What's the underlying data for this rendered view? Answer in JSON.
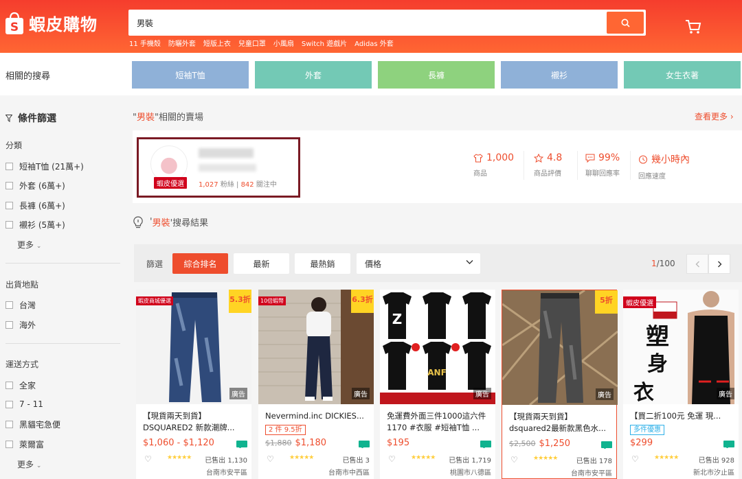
{
  "header": {
    "logo_text": "蝦皮購物",
    "search_value": "男裝",
    "hot_words": [
      "11 手機殼",
      "防曬外套",
      "短版上衣",
      "兒童口罩",
      "小風扇",
      "Switch 遊戲片",
      "Adidas 外套"
    ]
  },
  "related": {
    "title": "相關的搜尋",
    "chips": [
      {
        "label": "短袖T恤",
        "color": "#8fb1d8"
      },
      {
        "label": "外套",
        "color": "#73c9b5"
      },
      {
        "label": "長褲",
        "color": "#8ed27e"
      },
      {
        "label": "襯衫",
        "color": "#8fb1d8"
      },
      {
        "label": "女生衣著",
        "color": "#73c9b5"
      }
    ]
  },
  "sidebar": {
    "filter_title": "條件篩選",
    "category": {
      "title": "分類",
      "items": [
        "短袖T恤 (21萬+)",
        "外套 (6萬+)",
        "長褲 (6萬+)",
        "襯衫 (5萬+)"
      ],
      "more": "更多"
    },
    "location": {
      "title": "出貨地點",
      "items": [
        "台灣",
        "海外"
      ]
    },
    "shipping": {
      "title": "運送方式",
      "items": [
        "全家",
        "7 - 11",
        "黑貓宅急便",
        "萊爾富"
      ],
      "more": "更多"
    }
  },
  "shop_section": {
    "prefix": "\"",
    "keyword": "男裝",
    "suffix": "\"相關的賣場",
    "see_more": "查看更多 ›",
    "badge": "蝦皮優選",
    "followers": "1,027",
    "followers_label": "粉絲",
    "following": "842",
    "following_label": "關注中",
    "stats": [
      {
        "value": "1,000",
        "label": "商品",
        "icon": "shirt-icon"
      },
      {
        "value": "4.8",
        "label": "商品評價",
        "icon": "star-icon"
      },
      {
        "value": "99%",
        "label": "聊聊回應率",
        "icon": "chat-icon"
      },
      {
        "value": "幾小時內",
        "label": "回應速度",
        "icon": "clock-icon"
      }
    ]
  },
  "results": {
    "prefix": "'",
    "keyword": "男裝",
    "suffix": "'搜尋結果"
  },
  "sort_bar": {
    "label": "篩選",
    "options": [
      "綜合排名",
      "最新",
      "最熱銷"
    ],
    "active_index": 0,
    "price_label": "價格",
    "page_current": "1",
    "page_total": "/100"
  },
  "products": [
    {
      "name": "【現貨兩天到貨】DSQUARED2 新款潮牌...",
      "chip": "",
      "old_price": "",
      "price": "$1,060 - $1,120",
      "sold": "已售出 1,130",
      "location": "台南市安平區",
      "discount": "5.3折",
      "tag": "蝦皮商城優選",
      "ad": "廣告",
      "rating": 5,
      "highlight": false
    },
    {
      "name": "Nevermind.inc DICKIES...",
      "chip": "2 件 9.5折",
      "old_price": "$1,880",
      "price": "$1,180",
      "sold": "已售出 3",
      "location": "台南市中西區",
      "discount": "6.3折",
      "tag": "10倍蝦幣",
      "ad": "廣告",
      "rating": 5,
      "highlight": false
    },
    {
      "name": "免運費外面三件1000這六件1170 #衣服 #短袖T恤 ...",
      "chip": "",
      "old_price": "",
      "price": "$195",
      "sold": "已售出 1,719",
      "location": "桃園市八德區",
      "discount": "",
      "tag": "",
      "ad": "廣告",
      "rating": 5,
      "highlight": false
    },
    {
      "name": "【現貨兩天到貨】dsquared2最新款黑色水...",
      "chip": "",
      "old_price": "$2,500",
      "price": "$1,250",
      "sold": "已售出 178",
      "location": "台南市安平區",
      "discount": "5折",
      "tag": "",
      "ad": "廣告",
      "rating": 5,
      "highlight": true
    },
    {
      "name": "【買二折100元 免運 現...",
      "chip": "多件優惠",
      "old_price": "",
      "price": "$299",
      "sold": "已售出 928",
      "location": "新北市汐止區",
      "discount": "",
      "tag": "蝦皮優選",
      "ad": "廣告",
      "rating": 5,
      "highlight": false
    }
  ],
  "colors": {
    "brand": "#ee4d2d",
    "header": "#f53d2d",
    "star": "#ffce3d"
  }
}
